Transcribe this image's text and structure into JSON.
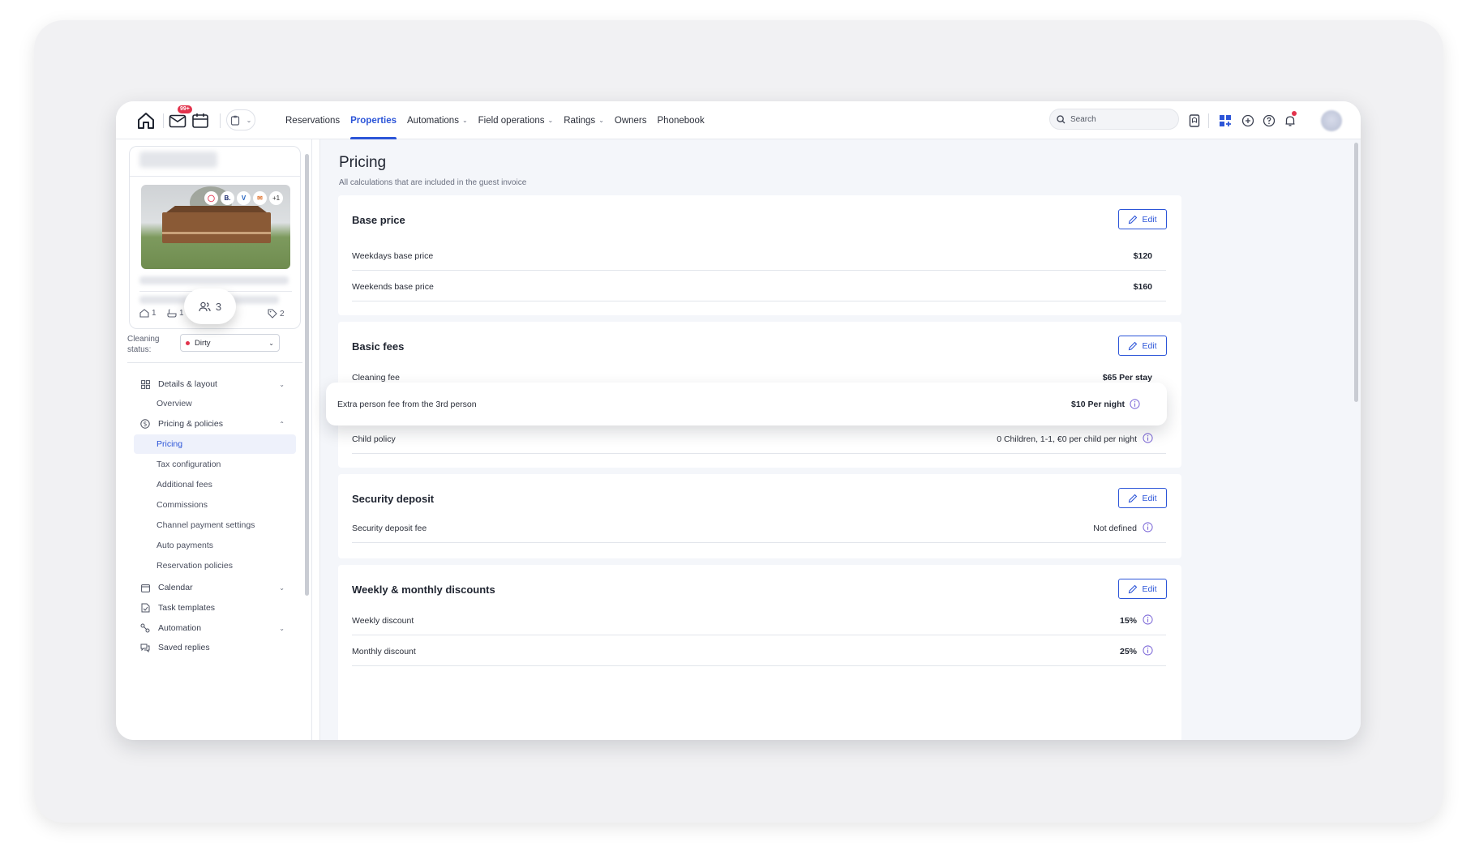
{
  "nav": {
    "mail_badge": "99+",
    "dropdown_icon": "clipboard-icon",
    "items": [
      {
        "label": "Reservations",
        "has_caret": false
      },
      {
        "label": "Properties",
        "has_caret": false,
        "active": true
      },
      {
        "label": "Automations",
        "has_caret": true
      },
      {
        "label": "Field operations",
        "has_caret": true
      },
      {
        "label": "Ratings",
        "has_caret": true
      },
      {
        "label": "Owners",
        "has_caret": false
      },
      {
        "label": "Phonebook",
        "has_caret": false
      }
    ],
    "search_placeholder": "Search",
    "accent_color": "#2c55d8"
  },
  "property_card": {
    "channels": [
      "airbnb",
      "B.",
      "vrbo",
      "chat"
    ],
    "channels_more": "+1",
    "bedrooms": "1",
    "bathrooms": "1",
    "guests": "3",
    "tags": "2"
  },
  "cleaning": {
    "label": "Cleaning status:",
    "value": "Dirty",
    "status_color": "#e2334c"
  },
  "sidebar_nav": {
    "details_layout": "Details & layout",
    "overview": "Overview",
    "pricing_policies": "Pricing & policies",
    "sub_items": [
      {
        "label": "Pricing",
        "active": true
      },
      {
        "label": "Tax configuration"
      },
      {
        "label": "Additional fees"
      },
      {
        "label": "Commissions"
      },
      {
        "label": "Channel payment settings"
      },
      {
        "label": "Auto payments"
      },
      {
        "label": "Reservation policies"
      }
    ],
    "calendar": "Calendar",
    "task_templates": "Task templates",
    "automation": "Automation",
    "saved_replies": "Saved replies"
  },
  "page": {
    "title": "Pricing",
    "subtitle": "All calculations that are included in the guest invoice"
  },
  "edit_label": "Edit",
  "sections": {
    "base_price": {
      "title": "Base price",
      "rows": [
        {
          "label": "Weekdays base price",
          "value": "$120"
        },
        {
          "label": "Weekends base price",
          "value": "$160"
        }
      ]
    },
    "basic_fees": {
      "title": "Basic fees",
      "cleaning_fee": {
        "label": "Cleaning fee",
        "value": "$65 Per stay"
      },
      "extra_person": {
        "label": "Extra person fee from the 3rd person",
        "value": "$10 Per night"
      },
      "child_policy": {
        "label": "Child policy",
        "value": "0 Children, 1-1, €0 per child per night"
      }
    },
    "security_deposit": {
      "title": "Security deposit",
      "row": {
        "label": "Security deposit fee",
        "value": "Not defined"
      }
    },
    "discounts": {
      "title": "Weekly & monthly discounts",
      "rows": [
        {
          "label": "Weekly discount",
          "value": "15%"
        },
        {
          "label": "Monthly discount",
          "value": "25%"
        }
      ]
    }
  }
}
